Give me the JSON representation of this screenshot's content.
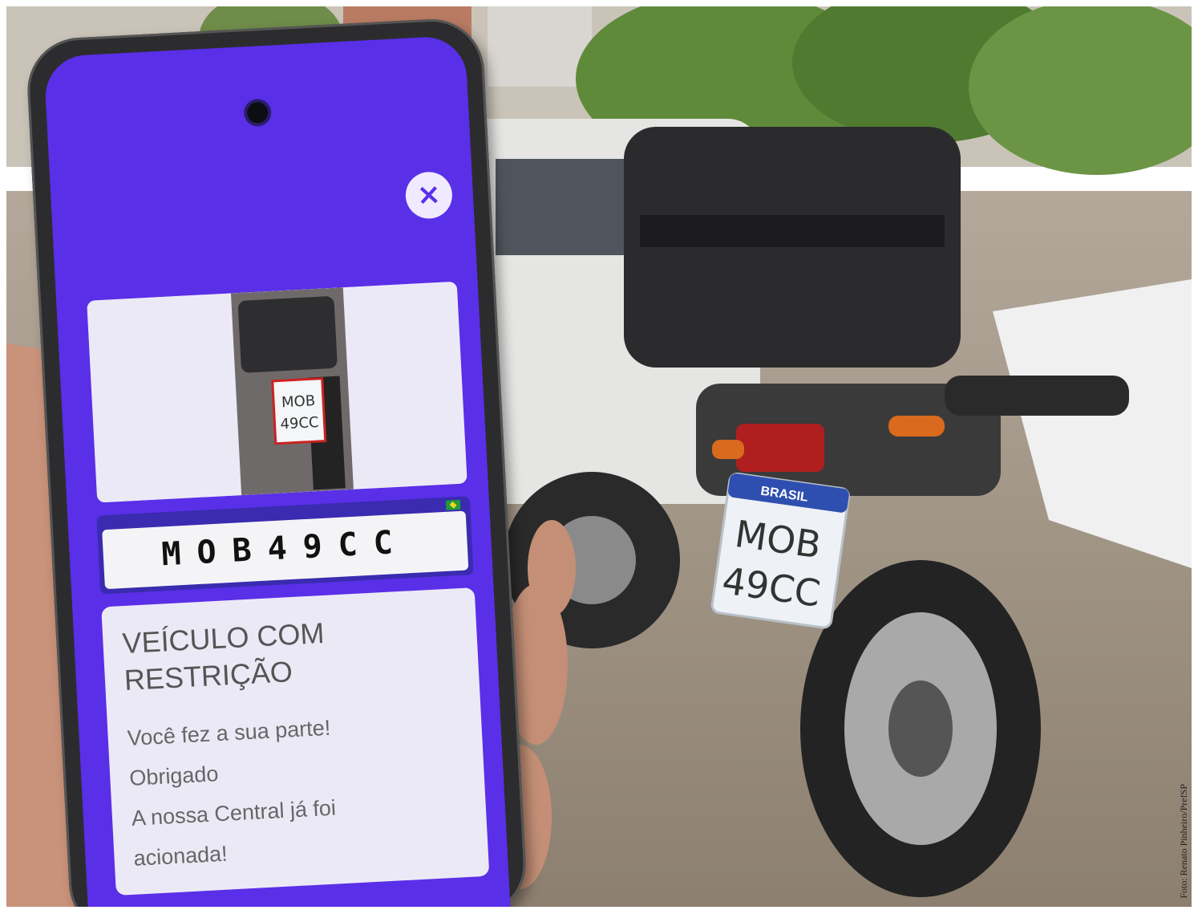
{
  "app_screen": {
    "close_symbol": "×",
    "plate_number": "MOB49CC",
    "photo_plate_line1": "MOB",
    "photo_plate_line2": "49CC",
    "status_title": "VEÍCULO COM RESTRIÇÃO",
    "message_line1": "Você fez a sua parte!",
    "message_line2": "Obrigado",
    "message_line3": "A nossa Central já foi",
    "message_line4": "acionada!",
    "accent_color": "#5a2fe8"
  },
  "scene": {
    "rear_plate_country": "BRASIL",
    "rear_plate_line1": "MOB",
    "rear_plate_line2": "49CC"
  },
  "credit": "Foto: Renato Pinheiro/PrefSP"
}
